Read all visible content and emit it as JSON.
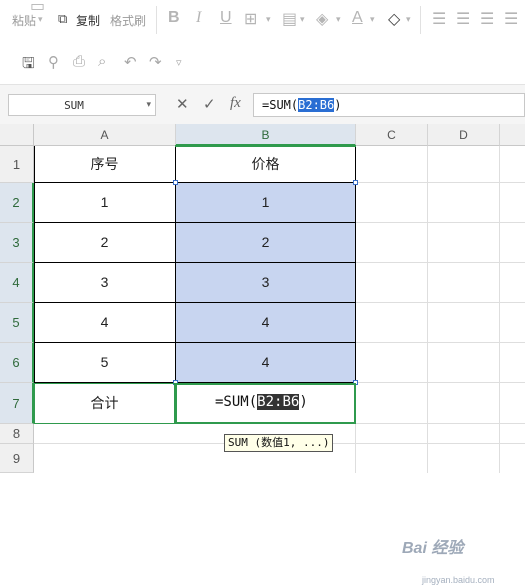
{
  "ribbon": {
    "paste_label": "粘贴",
    "copy_label": "复制",
    "format_painter_label": "格式刷",
    "bold_icon": "B",
    "italic_icon": "I",
    "underline_icon": "U",
    "font_color_icon": "A"
  },
  "quick_access": {
    "icons": [
      "save-icon",
      "cloud-icon",
      "print-icon",
      "preview-icon",
      "undo-icon",
      "redo-icon",
      "customize-icon"
    ]
  },
  "formula_bar": {
    "name_box": "SUM",
    "cancel_icon": "✕",
    "confirm_icon": "✓",
    "fx_icon": "fx",
    "formula_prefix": "=SUM(",
    "formula_range": "B2:B6",
    "formula_suffix": ")"
  },
  "grid": {
    "columns": [
      "A",
      "B",
      "C",
      "D"
    ],
    "rows": [
      "1",
      "2",
      "3",
      "4",
      "5",
      "6",
      "7",
      "8",
      "9"
    ],
    "header": {
      "a": "序号",
      "b": "价格"
    },
    "data": [
      {
        "a": "1",
        "b": "1"
      },
      {
        "a": "2",
        "b": "2"
      },
      {
        "a": "3",
        "b": "3"
      },
      {
        "a": "4",
        "b": "4"
      },
      {
        "a": "5",
        "b": "4"
      }
    ],
    "total_label": "合计",
    "editing": {
      "prefix": "=SUM(",
      "range": "B2:B6",
      "suffix": ")"
    },
    "tooltip": "SUM (数值1, ...)"
  },
  "watermark": {
    "brand": "Bai 经验",
    "sub": "jingyan.baidu.com"
  },
  "colors": {
    "selection": "#c8d5f0",
    "active_border": "#2f9a4d",
    "formula_highlight": "#2a6ed3"
  }
}
